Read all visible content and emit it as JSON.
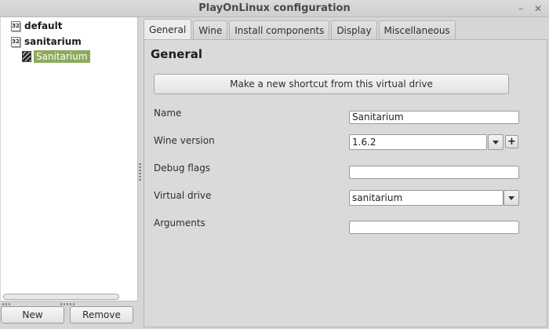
{
  "window": {
    "title": "PlayOnLinux configuration"
  },
  "tree": {
    "items": [
      {
        "label": "default",
        "icon": "32-bit-drive-icon",
        "icon_text": "32"
      },
      {
        "label": "sanitarium",
        "icon": "32-bit-drive-icon",
        "icon_text": "32"
      }
    ],
    "child": {
      "label": "Sanitarium",
      "icon": "game-thumbnail-icon"
    }
  },
  "buttons": {
    "new": "New",
    "remove": "Remove"
  },
  "tabs": [
    {
      "label": "General",
      "active": true
    },
    {
      "label": "Wine"
    },
    {
      "label": "Install components"
    },
    {
      "label": "Display"
    },
    {
      "label": "Miscellaneous"
    }
  ],
  "general": {
    "heading": "General",
    "shortcut_button": "Make a new shortcut from this virtual drive",
    "name_label": "Name",
    "name_value": "Sanitarium",
    "wine_version_label": "Wine version",
    "wine_version_value": "1.6.2",
    "debug_flags_label": "Debug flags",
    "debug_flags_value": "",
    "virtual_drive_label": "Virtual drive",
    "virtual_drive_value": "sanitarium",
    "arguments_label": "Arguments",
    "arguments_value": ""
  },
  "colors": {
    "selection": "#8daa5c",
    "background": "#d6d6d6"
  }
}
